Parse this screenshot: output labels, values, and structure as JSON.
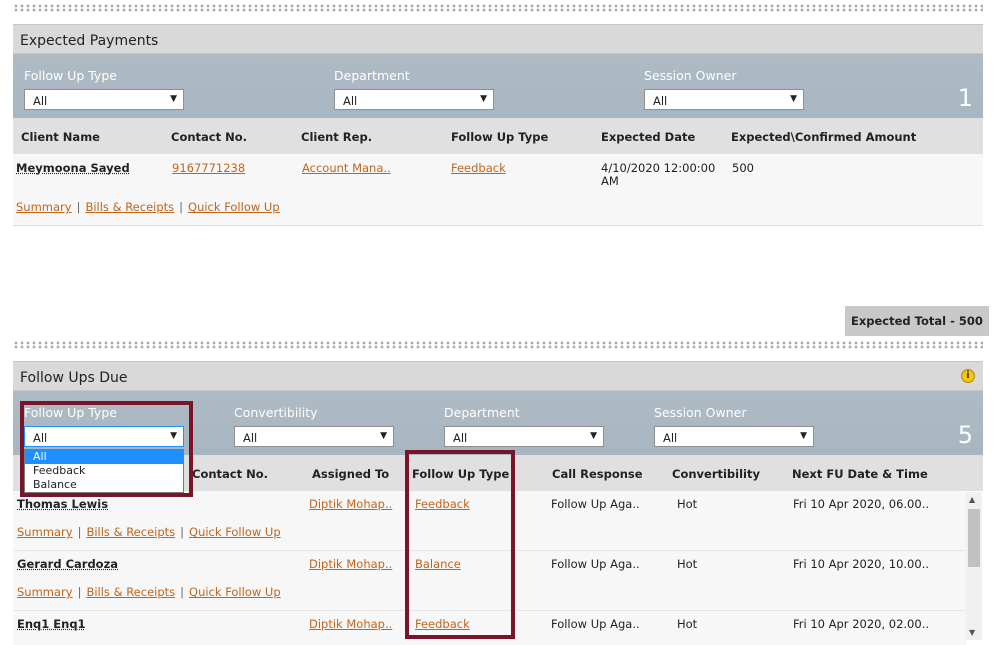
{
  "expected": {
    "title": "Expected Payments",
    "filters": [
      {
        "label": "Follow Up Type",
        "value": "All"
      },
      {
        "label": "Department",
        "value": "All"
      },
      {
        "label": "Session Owner",
        "value": "All"
      }
    ],
    "count": "1",
    "columns": [
      "Client Name",
      "Contact No.",
      "Client Rep.",
      "Follow Up Type",
      "Expected Date",
      "Expected\\Confirmed Amount"
    ],
    "row": {
      "client": "Meymoona Sayed",
      "contact": "9167771238",
      "rep": "Account Mana..",
      "type": "Feedback",
      "date_line1": "4/10/2020 12:00:00",
      "date_line2": "AM",
      "amount": "500"
    },
    "links": [
      "Summary",
      "Bills & Receipts",
      "Quick Follow Up"
    ],
    "total": "Expected Total - 500"
  },
  "followups": {
    "title": "Follow Ups Due",
    "info_icon": "info-icon",
    "filters": [
      {
        "label": "Follow Up Type",
        "value": "All"
      },
      {
        "label": "Convertibility",
        "value": "All"
      },
      {
        "label": "Department",
        "value": "All"
      },
      {
        "label": "Session Owner",
        "value": "All"
      }
    ],
    "count": "5",
    "dropdown_options": [
      "All",
      "Feedback",
      "Balance"
    ],
    "columns": [
      "Contact No.",
      "Assigned To",
      "Follow Up Type",
      "Call Response",
      "Convertibility",
      "Next FU Date & Time"
    ],
    "links": [
      "Summary",
      "Bills & Receipts",
      "Quick Follow Up"
    ],
    "rows": [
      {
        "name": "Thomas Lewis",
        "assigned": "Diptik Mohap..",
        "type": "Feedback",
        "response": "Follow Up Aga..",
        "conv": "Hot",
        "next": "Fri 10 Apr 2020, 06.00.."
      },
      {
        "name": "Gerard Cardoza",
        "assigned": "Diptik Mohap..",
        "type": "Balance",
        "response": "Follow Up Aga..",
        "conv": "Hot",
        "next": "Fri 10 Apr 2020, 10.00.."
      },
      {
        "name": "Enq1 Enq1",
        "assigned": "Diptik Mohap..",
        "type": "Feedback",
        "response": "Follow Up Aga..",
        "conv": "Hot",
        "next": "Fri 10 Apr 2020, 02.00.."
      }
    ]
  },
  "colors": {
    "accent_link": "#c0651c",
    "highlight_box": "#7a1428",
    "filter_bar": "#aebbc5"
  }
}
